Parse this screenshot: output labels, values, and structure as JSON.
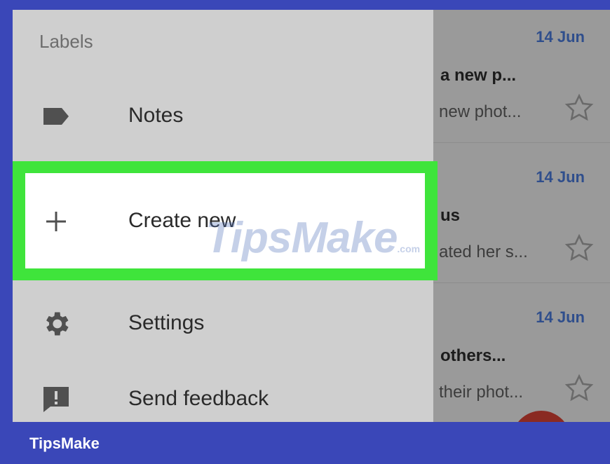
{
  "drawer": {
    "header": "Labels",
    "items": [
      {
        "label": "Notes",
        "icon": "label-tag-icon"
      },
      {
        "label": "Create new",
        "icon": "plus-icon"
      },
      {
        "label": "Settings",
        "icon": "gear-icon"
      },
      {
        "label": "Send feedback",
        "icon": "feedback-icon"
      }
    ]
  },
  "emails": [
    {
      "date": "14 Jun",
      "subject": "a new p...",
      "snippet": "new phot..."
    },
    {
      "date": "14 Jun",
      "subject": "us",
      "snippet": "ated her s..."
    },
    {
      "date": "14 Jun",
      "subject": "others...",
      "snippet": "their phot..."
    }
  ],
  "watermark": {
    "text": "TipsMake",
    "suffix": ".com"
  },
  "brand": {
    "text": "TipsMake"
  },
  "colors": {
    "frame": "#3a47b8",
    "highlight": "#3fe43b",
    "date": "#2f4e8c"
  }
}
